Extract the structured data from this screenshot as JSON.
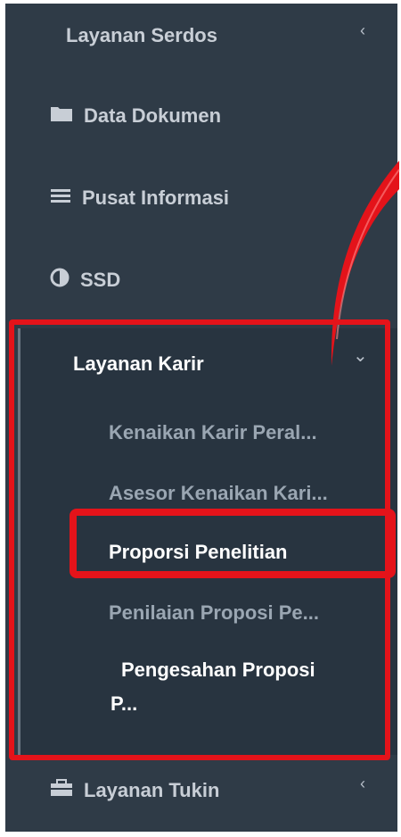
{
  "sidebar": {
    "items": [
      {
        "label": "Layanan Serdos",
        "icon": "none",
        "chevron": "‹"
      },
      {
        "label": "Data Dokumen",
        "icon": "folder-icon"
      },
      {
        "label": "Pusat Informasi",
        "icon": "list-icon"
      },
      {
        "label": "SSD",
        "icon": "half-circle-icon"
      },
      {
        "label": "Layanan Karir",
        "chevron": "⌄"
      },
      {
        "label": "Layanan Tukin",
        "icon": "briefcase-icon",
        "chevron": "‹"
      }
    ],
    "submenu": [
      {
        "label": "Kenaikan Karir Peral..."
      },
      {
        "label": "Asesor Kenaikan Kari..."
      },
      {
        "label": "Proporsi Penelitian"
      },
      {
        "label": "Penilaian Proposi Pe..."
      },
      {
        "label_line1": "Pengesahan Proposi",
        "label_line2": "P..."
      }
    ]
  },
  "colors": {
    "sidebar_bg": "#2f3b47",
    "submenu_bg": "#283440",
    "highlight": "#e4131a",
    "arrow": "#e4131a"
  }
}
